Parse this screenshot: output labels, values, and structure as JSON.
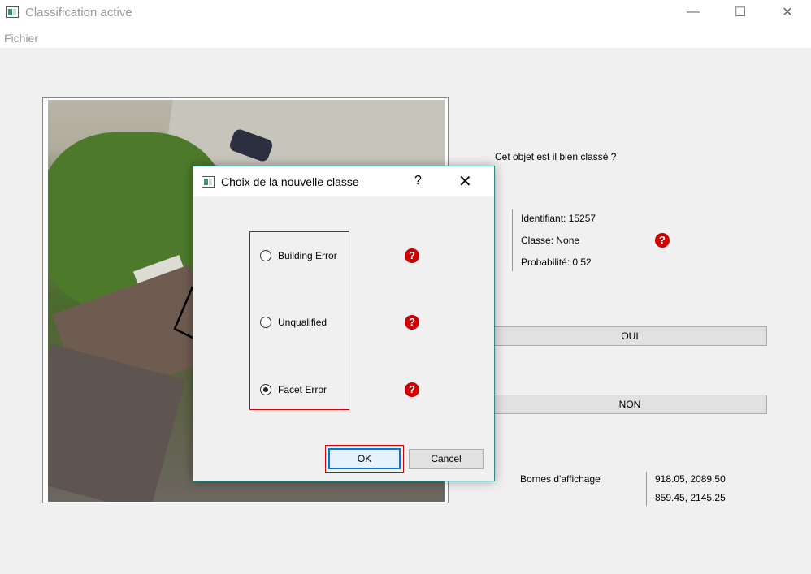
{
  "window": {
    "title": "Classification active",
    "controls": {
      "minimize": "—",
      "maximize": "☐",
      "close": "✕"
    }
  },
  "menu": {
    "items": [
      "Fichier"
    ]
  },
  "main": {
    "question": "Cet objet est il bien classé ?",
    "info": {
      "identifier": "Identifiant: 15257",
      "class": "Classe:  None",
      "probability": "Probabilité:  0.52"
    },
    "help_glyph": "?",
    "yes_button": "OUI",
    "no_button": "NON",
    "bounds_label": "Bornes d'affichage",
    "bounds_values": [
      "918.05, 2089.50",
      "859.45, 2145.25"
    ]
  },
  "dialog": {
    "title": "Choix de la nouvelle classe",
    "help": "?",
    "close": "✕",
    "options": [
      {
        "label": "Building Error",
        "checked": false
      },
      {
        "label": "Unqualified",
        "checked": false
      },
      {
        "label": "Facet Error",
        "checked": true
      }
    ],
    "ok_label": "OK",
    "cancel_label": "Cancel"
  },
  "colors": {
    "help_icon": "#cc0000",
    "highlight_border": "#dd0000",
    "focus_border": "#0078d7"
  }
}
